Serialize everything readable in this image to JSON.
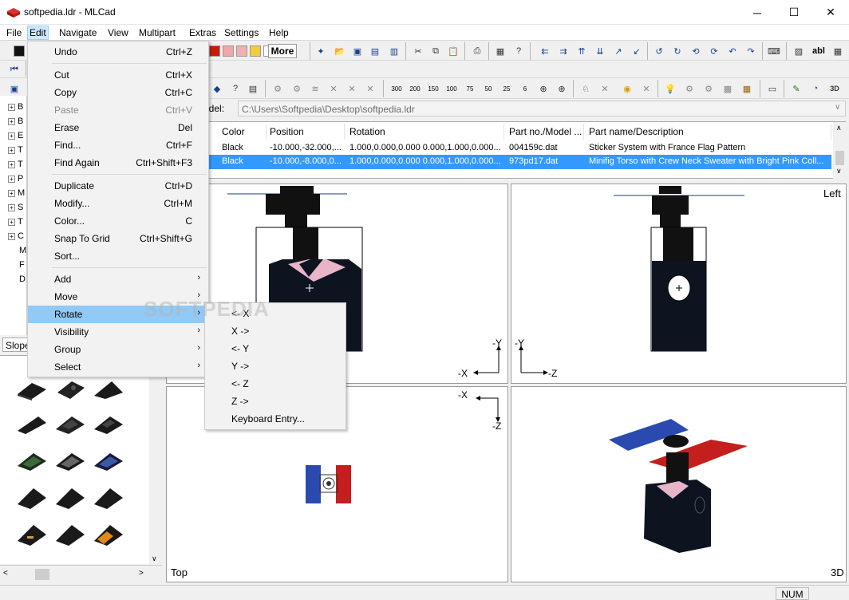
{
  "window": {
    "title": "softpedia.ldr - MLCad",
    "minimize_glyph": "─",
    "maximize_glyph": "☐",
    "close_glyph": "✕"
  },
  "menubar": {
    "items": [
      "File",
      "Edit",
      "Navigate",
      "View",
      "Multipart",
      "Extras",
      "Settings",
      "Help"
    ]
  },
  "toolbar": {
    "more_label": "More",
    "zoom_labels": [
      "300",
      "200",
      "150",
      "100",
      "75",
      "50",
      "25",
      "6"
    ],
    "abl_label": "abl",
    "colors": [
      "#000000",
      "#c91a09",
      "#f2a6a6",
      "#f0b0b0",
      "#f2cd37",
      "#ffffff"
    ]
  },
  "tree": {
    "items": [
      "B",
      "B",
      "E",
      "T",
      "T",
      "P",
      "M",
      "S",
      "T",
      "C",
      "M",
      "F",
      "D"
    ]
  },
  "model": {
    "label": "odel:",
    "path": "C:\\Users\\Softpedia\\Desktop\\softpedia.ldr"
  },
  "parts_table": {
    "headers": [
      "Color",
      "Position",
      "Rotation",
      "Part no./Model ...",
      "Part name/Description"
    ],
    "rows": [
      {
        "color": "Black",
        "position": "-10.000,-32.000,...",
        "rotation": "1.000,0.000,0.000 0.000,1.000,0.000...",
        "part_no": "004159c.dat",
        "description": "Sticker System with France Flag Pattern"
      },
      {
        "color": "Black",
        "position": "-10.000,-8.000,0...",
        "rotation": "1.000,0.000,0.000 0.000,1.000,0.000...",
        "part_no": "973pd17.dat",
        "description": "Minifig Torso with Crew Neck Sweater with Bright Pink Coll..."
      }
    ]
  },
  "side_tab": {
    "label": "Slope"
  },
  "viewports": {
    "front": {
      "label": "",
      "axis_up": "-Y",
      "axis_left": "-X"
    },
    "left": {
      "label": "Left",
      "axis_up": "-Y",
      "axis_right": "-Z"
    },
    "top": {
      "label": "Top",
      "axis_left": "-X",
      "axis_down": "-Z"
    },
    "threed": {
      "label": "3D"
    }
  },
  "edit_menu": {
    "items": [
      {
        "label": "Undo",
        "shortcut": "Ctrl+Z"
      },
      {
        "label": "Cut",
        "shortcut": "Ctrl+X"
      },
      {
        "label": "Copy",
        "shortcut": "Ctrl+C"
      },
      {
        "label": "Paste",
        "shortcut": "Ctrl+V"
      },
      {
        "label": "Erase",
        "shortcut": "Del"
      },
      {
        "label": "Find...",
        "shortcut": "Ctrl+F"
      },
      {
        "label": "Find Again",
        "shortcut": "Ctrl+Shift+F3"
      },
      {
        "label": "Duplicate",
        "shortcut": "Ctrl+D"
      },
      {
        "label": "Modify...",
        "shortcut": "Ctrl+M"
      },
      {
        "label": "Color...",
        "shortcut": "C"
      },
      {
        "label": "Snap To Grid",
        "shortcut": "Ctrl+Shift+G"
      },
      {
        "label": "Sort...",
        "shortcut": ""
      },
      {
        "label": "Add",
        "shortcut": ""
      },
      {
        "label": "Move",
        "shortcut": ""
      },
      {
        "label": "Rotate",
        "shortcut": ""
      },
      {
        "label": "Visibility",
        "shortcut": ""
      },
      {
        "label": "Group",
        "shortcut": ""
      },
      {
        "label": "Select",
        "shortcut": ""
      }
    ]
  },
  "rotate_menu": {
    "items": [
      "<- X",
      "X ->",
      "<- Y",
      "Y ->",
      "<- Z",
      "Z ->",
      "Keyboard Entry..."
    ]
  },
  "watermark": "SOFTPEDIA",
  "statusbar": {
    "num": "NUM"
  }
}
